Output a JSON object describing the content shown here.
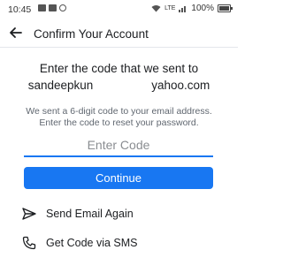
{
  "status_bar": {
    "time": "10:45",
    "left_icons": [
      "gallery-icon",
      "youtube-icon",
      "whatsapp-icon"
    ],
    "network": "LTE",
    "battery": "100%"
  },
  "header": {
    "back_icon": "arrow-left-icon",
    "title": "Confirm Your Account"
  },
  "instruction": {
    "line1": "Enter the code that we sent to",
    "email_part1": "sandeepkun",
    "email_part2": "yahoo.com"
  },
  "info": "We sent a 6-digit code to your email address. Enter the code to reset your password.",
  "code_field": {
    "placeholder": "Enter Code",
    "value": ""
  },
  "continue_label": "Continue",
  "actions": [
    {
      "icon": "send-icon",
      "label": "Send Email Again"
    },
    {
      "icon": "phone-icon",
      "label": "Get Code via SMS"
    }
  ],
  "colors": {
    "accent": "#1877f2",
    "text": "#1c1e21",
    "muted": "#606770"
  }
}
